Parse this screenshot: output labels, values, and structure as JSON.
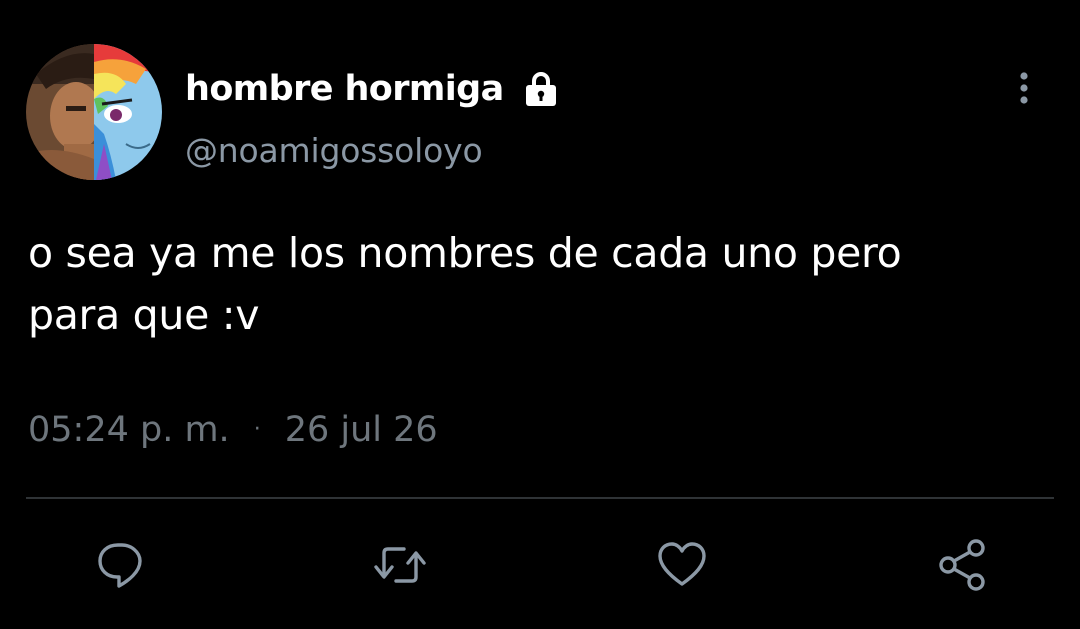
{
  "tweet": {
    "author": {
      "display_name": "hombre hormiga",
      "handle": "@noamigossoloyo",
      "verified_icon": "lock-icon",
      "avatar_icon": "avatar-image"
    },
    "text": "o sea ya me los nombres de cada uno pero\npara que :v",
    "time": "05:24 p. m.",
    "separator": "·",
    "date": "26 jul 26",
    "actions": [
      {
        "name": "reply",
        "icon": "comment-icon"
      },
      {
        "name": "retweet",
        "icon": "retweet-icon"
      },
      {
        "name": "like",
        "icon": "heart-icon"
      },
      {
        "name": "share",
        "icon": "share-icon"
      }
    ],
    "more_icon": "more-vertical-icon"
  },
  "colors": {
    "background": "#000000",
    "primary_text": "#ffffff",
    "secondary_text": "#8b98a5",
    "meta_text": "#6e767d",
    "divider": "#2f3336",
    "icon": "#8b98a5"
  }
}
